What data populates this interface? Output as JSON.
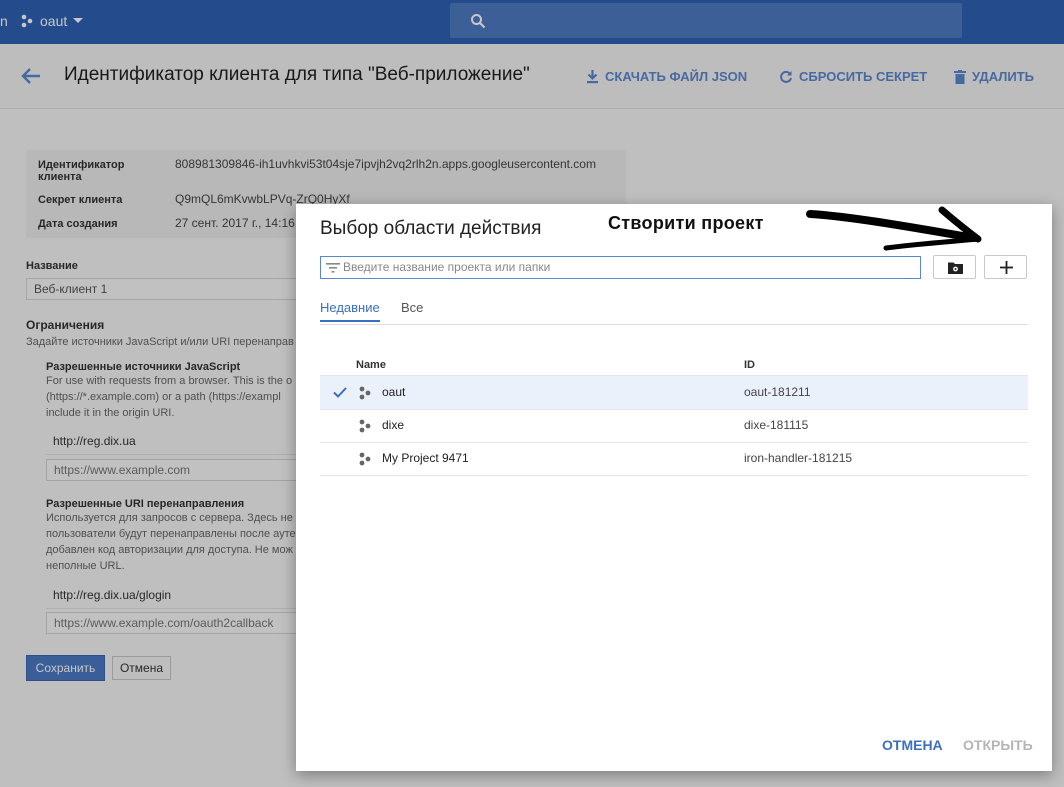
{
  "topbar": {
    "left_fragment": "n",
    "project_name": "oaut"
  },
  "header": {
    "title": "Идентификатор клиента для типа \"Веб-приложение\"",
    "download_label": "СКАЧАТЬ ФАЙЛ JSON",
    "reset_label": "СБРОСИТЬ СЕКРЕТ",
    "delete_label": "УДАЛИТЬ"
  },
  "client_info": {
    "id_label": "Идентификатор клиента",
    "id_value": "808981309846-ih1uvhkvi53t04sje7ipvjh2vq2rlh2n.apps.googleusercontent.com",
    "secret_label": "Секрет клиента",
    "secret_value": "Q9mQL6mKvwbLPVq-ZrQ0HyXf",
    "date_label": "Дата создания",
    "date_value": "27 сент. 2017 г., 14:16"
  },
  "form": {
    "name_label": "Название",
    "name_value": "Веб-клиент 1",
    "restrictions_title": "Ограничения",
    "restrictions_desc": "Задайте источники JavaScript и/или URI перенаправ",
    "js_title": "Разрешенные источники JavaScript",
    "js_desc": [
      "For use with requests from a browser. This is the o",
      "(https://*.example.com) or a path (https://exampl",
      "include it in the origin URI."
    ],
    "js_value": "http://reg.dix.ua",
    "js_placeholder": "https://www.example.com",
    "redirect_title": "Разрешенные URI перенаправления",
    "redirect_desc": [
      "Используется для запросов с сервера. Здесь не",
      "пользователи будут перенаправлены после ауте",
      "добавлен код авторизации для доступа. Не мож",
      "неполные URL."
    ],
    "redirect_value": "http://reg.dix.ua/glogin",
    "redirect_placeholder": "https://www.example.com/oauth2callback",
    "save_label": "Сохранить",
    "cancel_label": "Отмена"
  },
  "dialog": {
    "title": "Выбор области действия",
    "annotation": "Створити проект",
    "filter_placeholder": "Введите название проекта или папки",
    "tabs": [
      {
        "label": "Недавние",
        "active": true
      },
      {
        "label": "Все",
        "active": false
      }
    ],
    "columns": {
      "name": "Name",
      "id": "ID"
    },
    "projects": [
      {
        "name": "oaut",
        "id": "oaut-181211",
        "selected": true
      },
      {
        "name": "dixe",
        "id": "dixe-181115",
        "selected": false
      },
      {
        "name": "My Project 9471",
        "id": "iron-handler-181215",
        "selected": false
      }
    ],
    "cancel_label": "ОТМЕНА",
    "open_label": "ОТКРЫТЬ"
  },
  "colors": {
    "brand_blue": "#2f62b4",
    "accent": "#3b6fc0",
    "disabled": "#b5b5b5"
  },
  "icons": [
    "search-icon",
    "back-arrow-icon",
    "download-icon",
    "refresh-icon",
    "trash-icon",
    "filter-icon",
    "folder-settings-icon",
    "plus-icon",
    "checkmark-icon",
    "project-icon"
  ]
}
